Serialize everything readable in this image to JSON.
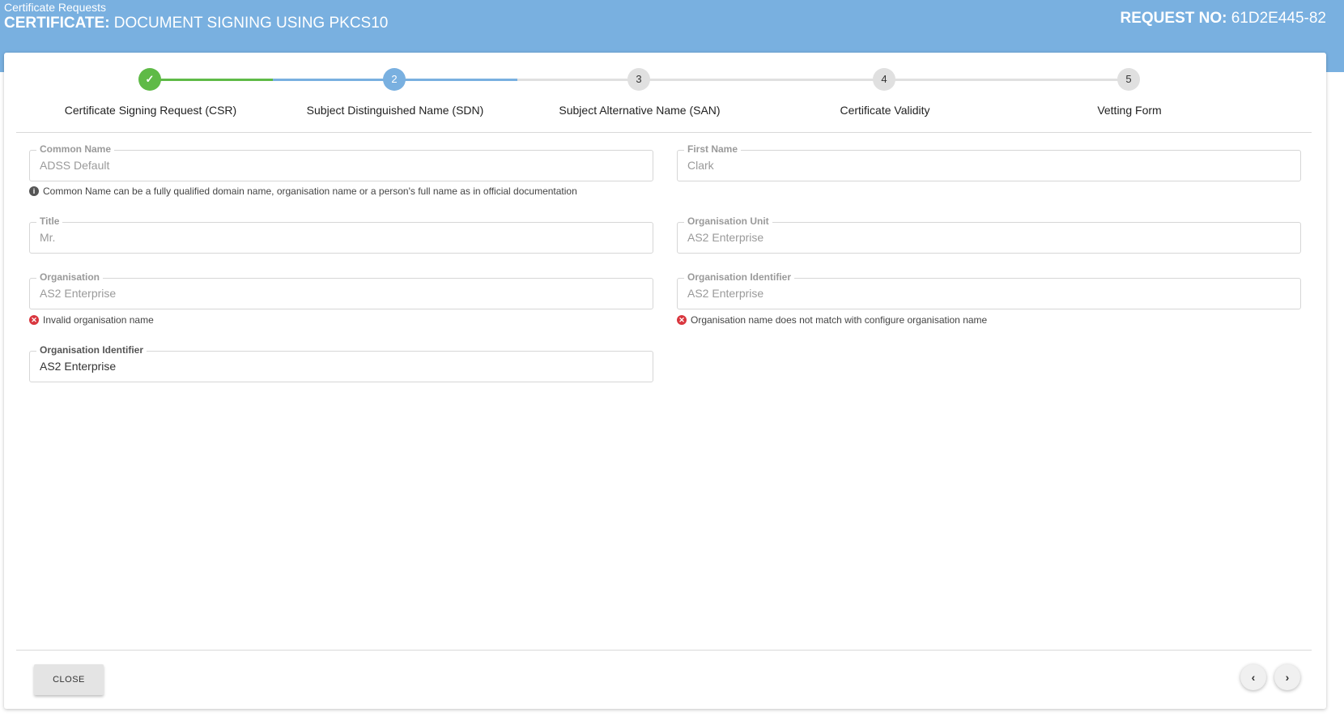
{
  "header": {
    "breadcrumb": "Certificate Requests",
    "title_prefix": "CERTIFICATE:",
    "title_rest": " DOCUMENT SIGNING USING PKCS10",
    "request_prefix": "REQUEST NO:",
    "request_no": " 61D2E445-82"
  },
  "stepper": {
    "steps": [
      {
        "number": "✓",
        "label": "Certificate Signing Request (CSR)",
        "state": "complete"
      },
      {
        "number": "2",
        "label": "Subject Distinguished Name (SDN)",
        "state": "active"
      },
      {
        "number": "3",
        "label": "Subject Alternative Name (SAN)",
        "state": "pending"
      },
      {
        "number": "4",
        "label": "Certificate Validity",
        "state": "pending"
      },
      {
        "number": "5",
        "label": "Vetting Form",
        "state": "pending"
      }
    ],
    "colors": {
      "complete": "#5fba47",
      "active": "#79b0e0",
      "pending": "#e0e0e0"
    }
  },
  "form": {
    "common_name": {
      "label": "Common Name",
      "value": "ADSS Default"
    },
    "common_name_hint": "Common Name can be a fully qualified domain name, organisation name or a person's full name as in official documentation",
    "first_name": {
      "label": "First Name",
      "value": "Clark"
    },
    "title": {
      "label": "Title",
      "value": "Mr."
    },
    "org_unit": {
      "label": "Organisation Unit",
      "value": "AS2 Enterprise"
    },
    "organisation": {
      "label": "Organisation",
      "value": "AS2 Enterprise"
    },
    "organisation_error": "Invalid organisation name",
    "org_identifier_1": {
      "label": "Organisation Identifier",
      "value": "AS2 Enterprise"
    },
    "org_identifier_1_error": "Organisation name does not match with configure organisation name",
    "org_identifier_2": {
      "label": "Organisation Identifier",
      "value": "AS2 Enterprise"
    }
  },
  "footer": {
    "close_label": "CLOSE",
    "prev_icon": "chevron-left-icon",
    "next_icon": "chevron-right-icon"
  }
}
